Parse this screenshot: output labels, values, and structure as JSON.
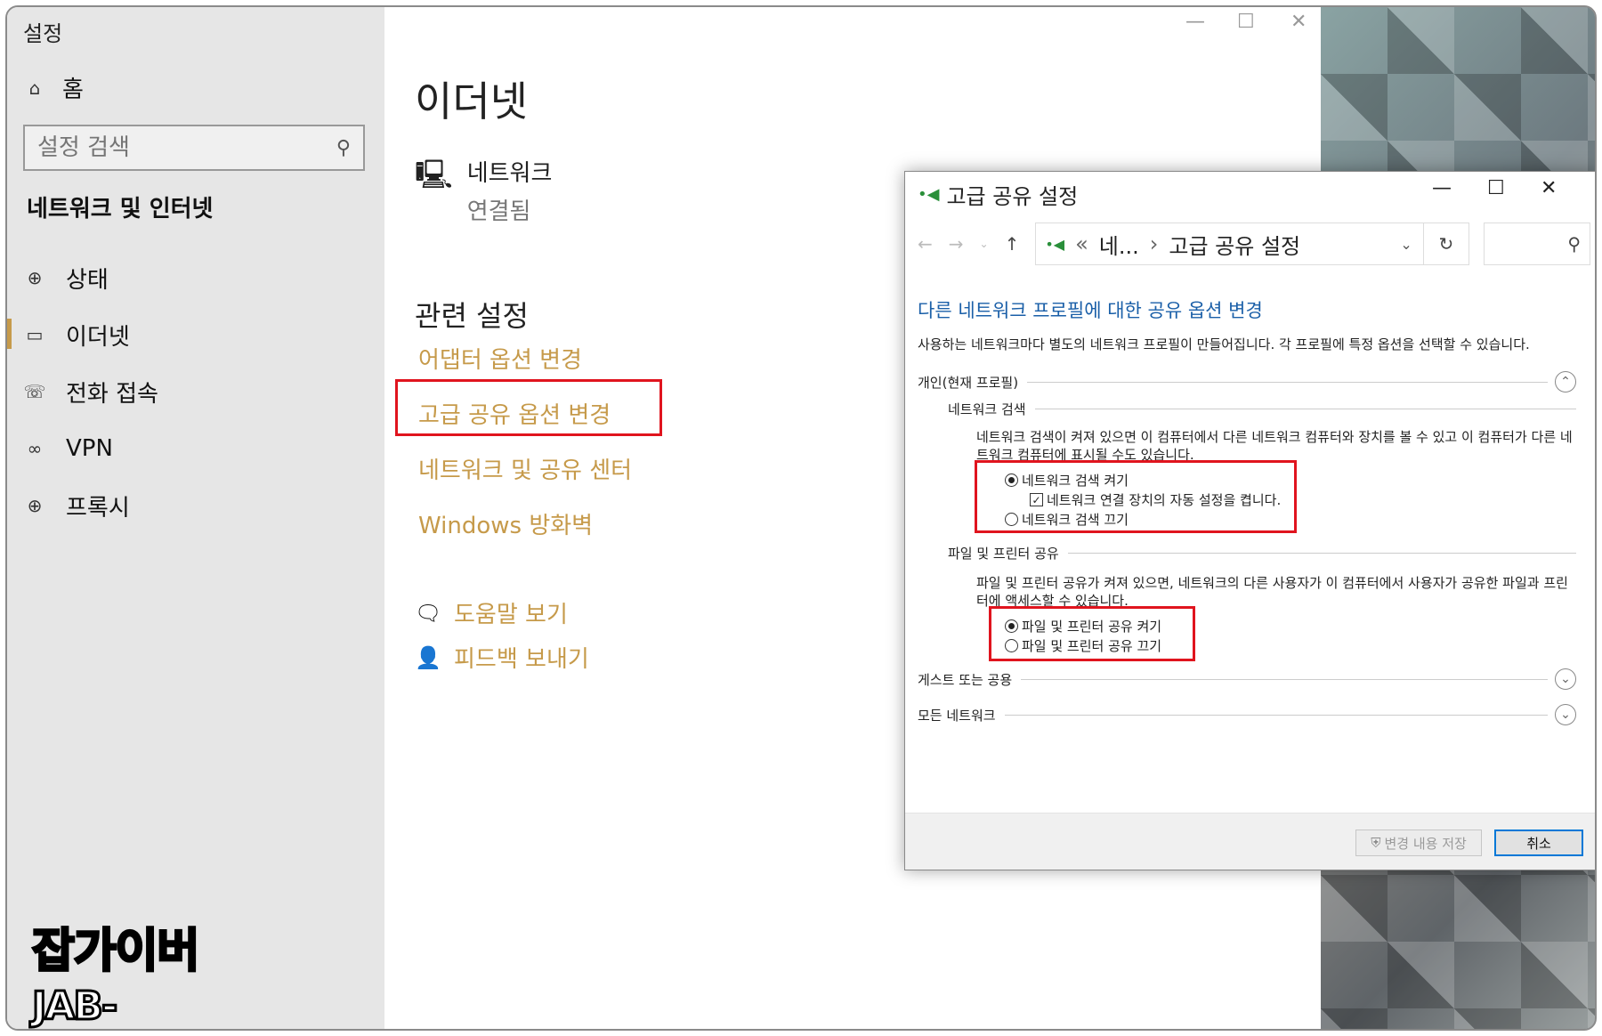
{
  "settings": {
    "app_title": "설정",
    "home_label": "홈",
    "search_placeholder": "설정 검색",
    "section_title": "네트워크 및 인터넷",
    "nav": [
      {
        "label": "상태",
        "icon": "globe-status-icon"
      },
      {
        "label": "이더넷",
        "icon": "ethernet-icon"
      },
      {
        "label": "전화 접속",
        "icon": "dialup-icon"
      },
      {
        "label": "VPN",
        "icon": "vpn-icon"
      },
      {
        "label": "프록시",
        "icon": "globe-icon"
      }
    ],
    "active_nav": "이더넷"
  },
  "main": {
    "page_title": "이더넷",
    "network_name": "네트워크",
    "network_status": "연결됨",
    "related_title": "관련 설정",
    "links": [
      "어댑터 옵션 변경",
      "고급 공유 옵션 변경",
      "네트워크 및 공유 센터",
      "Windows 방화벽"
    ],
    "help": "도움말 보기",
    "feedback": "피드백 보내기",
    "window_controls": [
      "—",
      "☐",
      "✕"
    ]
  },
  "dialog": {
    "title": "고급 공유 설정",
    "window_controls": [
      "—",
      "☐",
      "✕"
    ],
    "breadcrumb_prefix": "«",
    "breadcrumb_parent": "네...",
    "breadcrumb_sep": "›",
    "breadcrumb_current": "고급 공유 설정",
    "heading": "다른 네트워크 프로필에 대한 공유 옵션 변경",
    "description": "사용하는 네트워크마다 별도의 네트워크 프로필이 만들어집니다. 각 프로필에 특정 옵션을 선택할 수 있습니다.",
    "profile_private": "개인(현재 프로필)",
    "discovery": {
      "title": "네트워크 검색",
      "text": "네트워크 검색이 켜져 있으면 이 컴퓨터에서 다른 네트워크 컴퓨터와 장치를 볼 수 있고 이 컴퓨터가 다른 네트워크 컴퓨터에 표시될 수도 있습니다.",
      "on": "네트워크 검색 켜기",
      "auto_setup": "네트워크 연결 장치의 자동 설정을 켭니다.",
      "off": "네트워크 검색 끄기"
    },
    "file_sharing": {
      "title": "파일 및 프린터 공유",
      "text": "파일 및 프린터 공유가 켜져 있으면, 네트워크의 다른 사용자가 이 컴퓨터에서 사용자가 공유한 파일과 프린터에 액세스할 수 있습니다.",
      "on": "파일 및 프린터 공유 켜기",
      "off": "파일 및 프린터 공유 끄기"
    },
    "profile_guest": "게스트 또는 공용",
    "profile_all": "모든 네트워크",
    "save_button": "변경 내용 저장",
    "cancel_button": "취소"
  },
  "watermark": {
    "line1": "잡가이버",
    "line2": "JAB-GUYVER.CO.KR"
  },
  "colors": {
    "accent": "#c69a4a",
    "link_blue": "#1a5fa8",
    "highlight_red": "#e0141e",
    "sidebar_bg": "#e6e6e6"
  }
}
